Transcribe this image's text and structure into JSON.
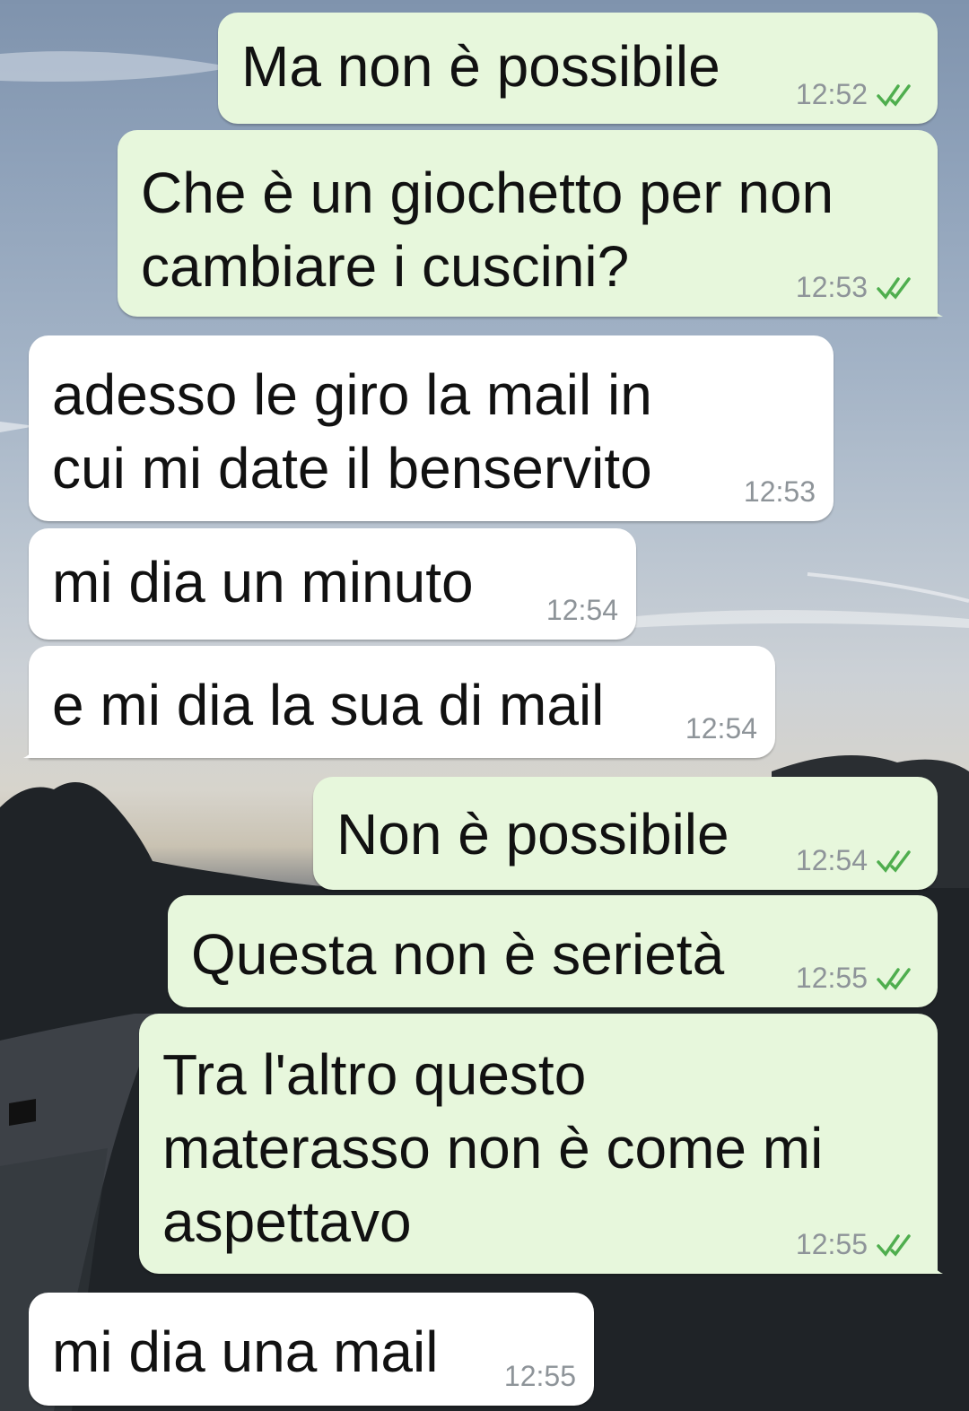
{
  "messages": [
    {
      "direction": "outgoing",
      "lines": [
        "Ma non è possibile"
      ],
      "time": "12:52",
      "status_icon": "double-check-icon"
    },
    {
      "direction": "outgoing",
      "lines": [
        "Che è un giochetto per non",
        "cambiare i cuscini?"
      ],
      "time": "12:53",
      "status_icon": "double-check-icon"
    },
    {
      "direction": "incoming",
      "lines": [
        "adesso le giro la mail in",
        "cui mi date il benservito"
      ],
      "time": "12:53"
    },
    {
      "direction": "incoming",
      "lines": [
        "mi dia un minuto"
      ],
      "time": "12:54"
    },
    {
      "direction": "incoming",
      "lines": [
        "e mi dia la sua di mail"
      ],
      "time": "12:54"
    },
    {
      "direction": "outgoing",
      "lines": [
        "Non è possibile"
      ],
      "time": "12:54",
      "status_icon": "double-check-icon"
    },
    {
      "direction": "outgoing",
      "lines": [
        "Questa non è serietà"
      ],
      "time": "12:55",
      "status_icon": "double-check-icon"
    },
    {
      "direction": "outgoing",
      "lines": [
        "Tra l'altro questo",
        "materasso non è come mi",
        "aspettavo"
      ],
      "time": "12:55",
      "status_icon": "double-check-icon"
    },
    {
      "direction": "incoming",
      "lines": [
        "mi dia una mail"
      ],
      "time": "12:55"
    }
  ],
  "colors": {
    "outgoing_bubble": "#e7f7dc",
    "incoming_bubble": "#ffffff",
    "read_ticks": "#4fae4e",
    "timestamp": "#8e9499"
  }
}
